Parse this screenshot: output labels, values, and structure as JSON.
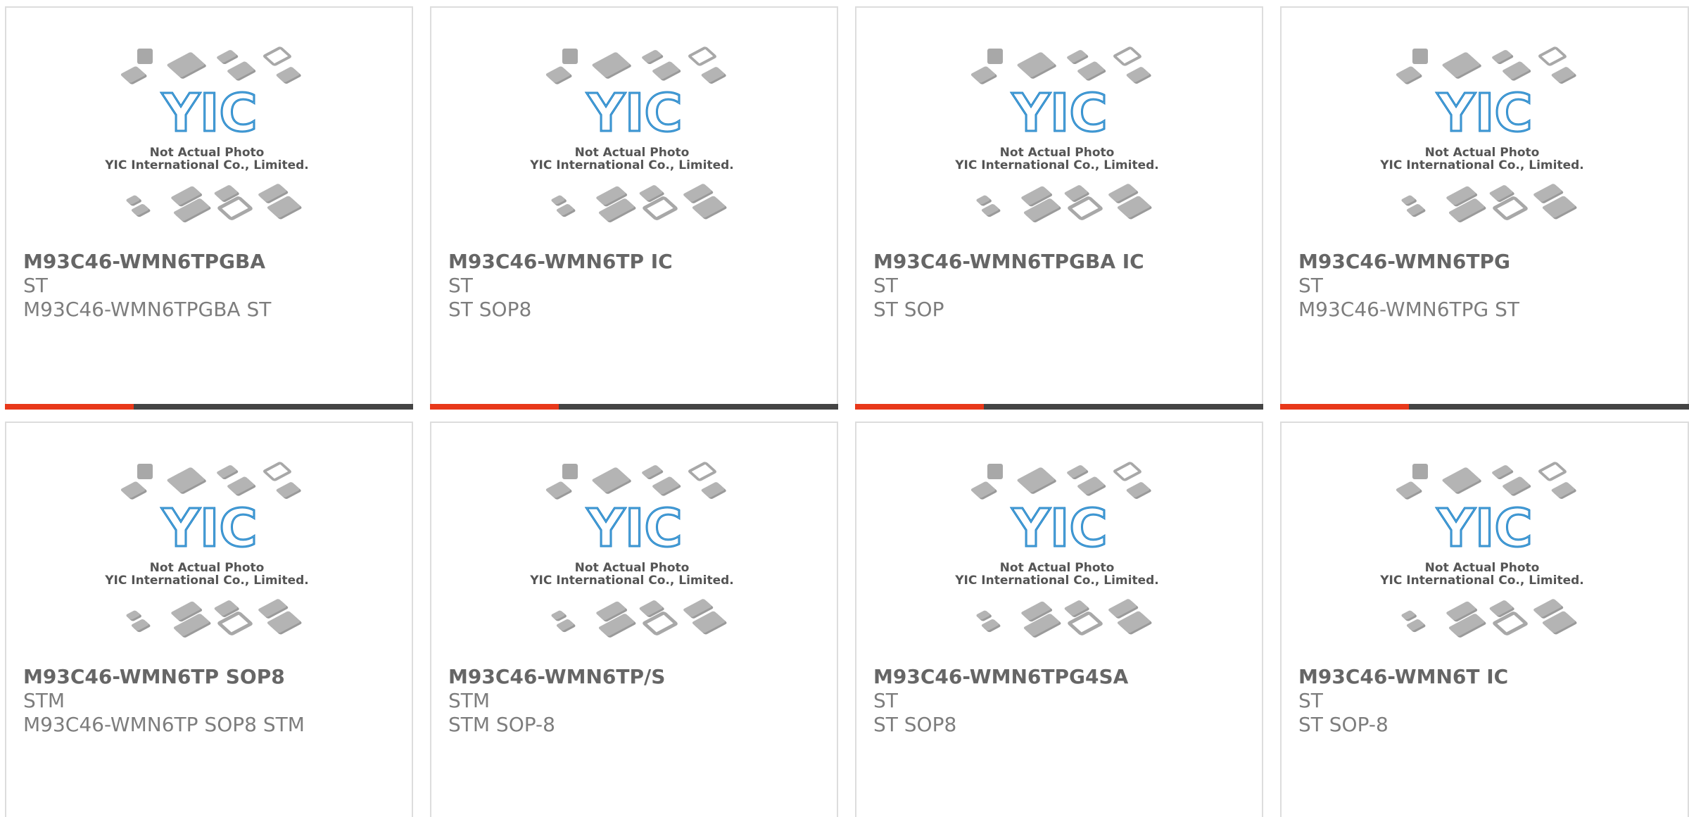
{
  "photo": {
    "logo_text": "YIC",
    "caption_line1": "Not Actual Photo",
    "caption_line2": "YIC International Co., Limited."
  },
  "colors": {
    "accent_bar": "#e8381a",
    "dark_bar": "#444444",
    "logo_blue": "#1f7fc4",
    "chip_gray": "#b4b4b4"
  },
  "products": [
    {
      "name": "M93C46-WMN6TPGBA",
      "brand": "ST",
      "desc": "M93C46-WMN6TPGBA ST"
    },
    {
      "name": "M93C46-WMN6TP IC",
      "brand": "ST",
      "desc": "ST SOP8"
    },
    {
      "name": "M93C46-WMN6TPGBA IC",
      "brand": "ST",
      "desc": "ST SOP"
    },
    {
      "name": "M93C46-WMN6TPG",
      "brand": "ST",
      "desc": "M93C46-WMN6TPG ST"
    },
    {
      "name": "M93C46-WMN6TP SOP8",
      "brand": "STM",
      "desc": "M93C46-WMN6TP SOP8 STM"
    },
    {
      "name": "M93C46-WMN6TP/S",
      "brand": "STM",
      "desc": "STM SOP-8"
    },
    {
      "name": "M93C46-WMN6TPG4SA",
      "brand": "ST",
      "desc": "ST SOP8"
    },
    {
      "name": "M93C46-WMN6T IC",
      "brand": "ST",
      "desc": "ST SOP-8"
    }
  ]
}
